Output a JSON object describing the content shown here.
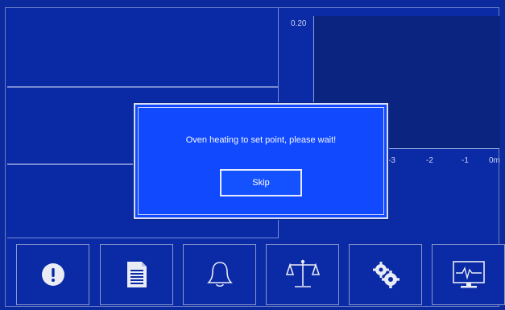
{
  "graph": {
    "y_tick_top": "0.20",
    "x_ticks": [
      "-3",
      "-2",
      "-1",
      "0m"
    ]
  },
  "dialog": {
    "message": "Oven heating to set point, please wait!",
    "skip_label": "Skip"
  },
  "toolbar": {
    "buttons": [
      {
        "icon": "alert-icon"
      },
      {
        "icon": "document-icon"
      },
      {
        "icon": "bell-icon"
      },
      {
        "icon": "balance-scale-icon"
      },
      {
        "icon": "gears-icon"
      },
      {
        "icon": "monitor-waveform-icon"
      }
    ]
  },
  "colors": {
    "background": "#0b2a9e",
    "dialog": "#1149ff",
    "border": "#8b98c9"
  }
}
